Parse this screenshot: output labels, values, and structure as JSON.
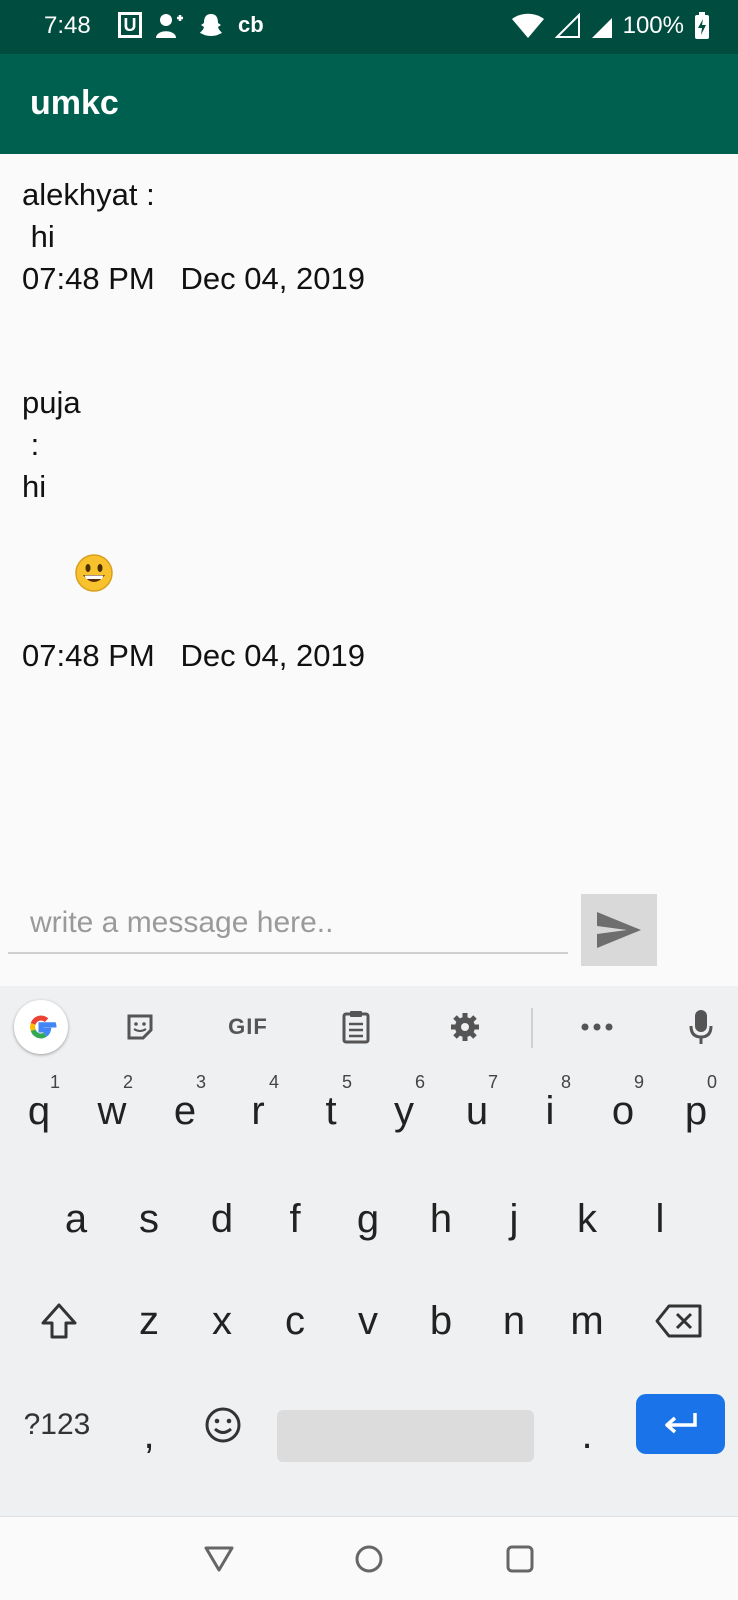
{
  "status_bar": {
    "time": "7:48",
    "left_icons": [
      "u-notification-icon",
      "add-person-icon",
      "snapchat-ghost-icon",
      "cb-icon"
    ],
    "cb_label": "cb",
    "u_label": "U",
    "battery_text": "100%"
  },
  "app_bar": {
    "title": "umkc"
  },
  "messages": [
    {
      "lines": [
        "alekhyat :",
        " hi",
        "07:48 PM   Dec 04, 2019"
      ]
    },
    {
      "lines": [
        "puja",
        " :",
        "hi"
      ],
      "emoji": "grinning-face",
      "timestamp": "07:48 PM   Dec 04, 2019"
    }
  ],
  "composer": {
    "placeholder": "write a message here..",
    "value": ""
  },
  "keyboard": {
    "toolbar": {
      "gif_label": "GIF"
    },
    "row1": [
      {
        "key": "q",
        "hint": "1"
      },
      {
        "key": "w",
        "hint": "2"
      },
      {
        "key": "e",
        "hint": "3"
      },
      {
        "key": "r",
        "hint": "4"
      },
      {
        "key": "t",
        "hint": "5"
      },
      {
        "key": "y",
        "hint": "6"
      },
      {
        "key": "u",
        "hint": "7"
      },
      {
        "key": "i",
        "hint": "8"
      },
      {
        "key": "o",
        "hint": "9"
      },
      {
        "key": "p",
        "hint": "0"
      }
    ],
    "row2": [
      "a",
      "s",
      "d",
      "f",
      "g",
      "h",
      "j",
      "k",
      "l"
    ],
    "row3": [
      "z",
      "x",
      "c",
      "v",
      "b",
      "n",
      "m"
    ],
    "symbols_label": "?123",
    "comma": ",",
    "period": "."
  },
  "colors": {
    "status_bar": "#004d40",
    "app_bar": "#00604f",
    "enter_key": "#1a73e8"
  }
}
